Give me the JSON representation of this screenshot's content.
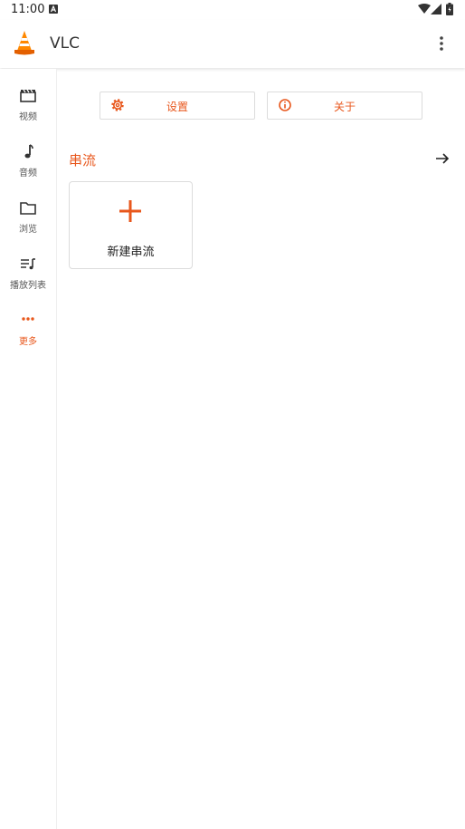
{
  "status_bar": {
    "time": "11:00"
  },
  "app_bar": {
    "title": "VLC"
  },
  "side_nav": {
    "items": [
      {
        "label": "视频",
        "icon": "video-icon"
      },
      {
        "label": "音频",
        "icon": "music-note-icon"
      },
      {
        "label": "浏览",
        "icon": "folder-icon"
      },
      {
        "label": "播放列表",
        "icon": "playlist-icon"
      },
      {
        "label": "更多",
        "icon": "more-horizontal-icon",
        "active": true
      }
    ]
  },
  "actions": {
    "settings_label": "设置",
    "about_label": "关于"
  },
  "streams": {
    "section_title": "串流",
    "new_stream_label": "新建串流"
  },
  "colors": {
    "accent": "#e8571c",
    "text": "#222222",
    "border": "#dcdcdc"
  }
}
